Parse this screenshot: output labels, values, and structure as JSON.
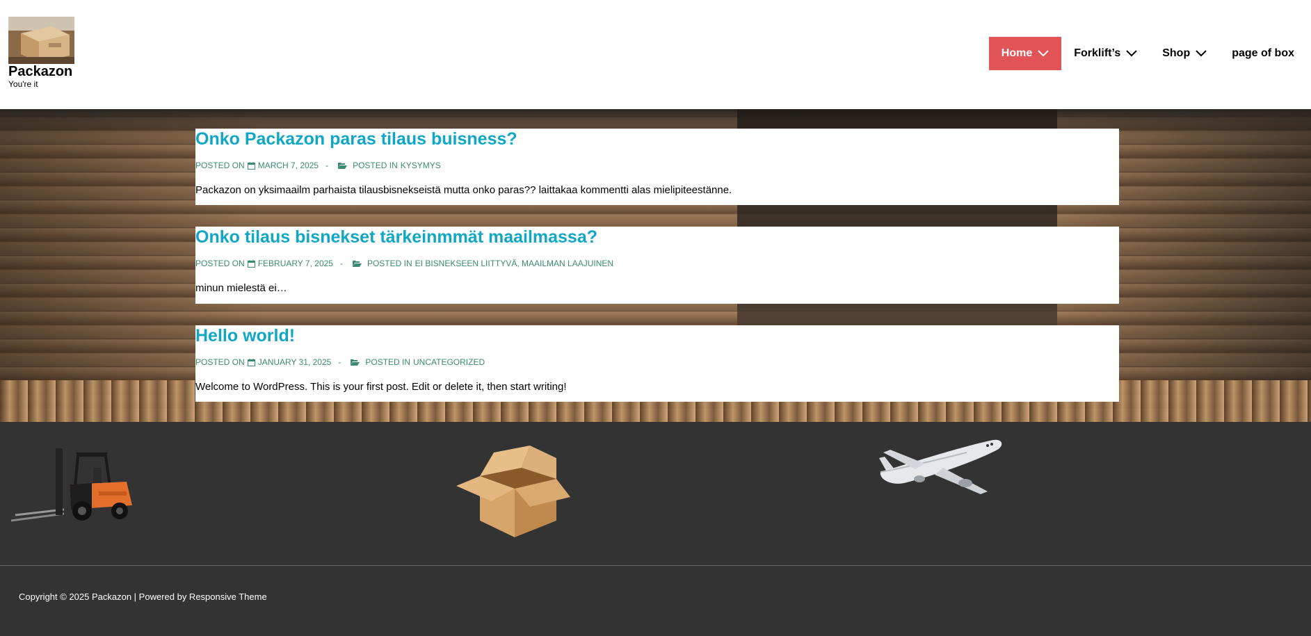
{
  "site": {
    "title": "Packazon",
    "tagline": "You're it"
  },
  "nav": {
    "items": [
      {
        "label": "Home",
        "active": true,
        "has_dropdown": true
      },
      {
        "label": "Forklift’s",
        "active": false,
        "has_dropdown": true
      },
      {
        "label": "Shop",
        "active": false,
        "has_dropdown": true
      },
      {
        "label": "page of box",
        "active": false,
        "has_dropdown": false
      }
    ]
  },
  "posts": [
    {
      "title": "Onko Packazon paras tilaus buisness?",
      "posted_on_label": "POSTED ON",
      "date": "MARCH 7, 2025",
      "posted_in_label": "POSTED IN",
      "categories": "KYSYMYS",
      "excerpt": "Packazon on yksimaailm parhaista  tilausbisnekseistä mutta onko paras?? laittakaa kommentti alas mielipiteestänne."
    },
    {
      "title": "Onko tilaus bisnekset tärkeinmmät maailmassa?",
      "posted_on_label": "POSTED ON",
      "date": "FEBRUARY 7, 2025",
      "posted_in_label": "POSTED IN",
      "categories": "EI BISNEKSEEN LIITTYVÄ, MAAILMAN LAAJUINEN",
      "excerpt": "minun mielestä ei…"
    },
    {
      "title": "Hello world!",
      "posted_on_label": "POSTED ON",
      "date": "JANUARY 31, 2025",
      "posted_in_label": "POSTED IN",
      "categories": "UNCATEGORIZED",
      "excerpt": "Welcome to WordPress. This is your first post. Edit or delete it, then start writing!"
    }
  ],
  "widgets": [
    {
      "icon": "forklift-image"
    },
    {
      "icon": "open-box-image"
    },
    {
      "icon": "airplane-image"
    }
  ],
  "footer": {
    "copyright": "Copyright © 2025 Packazon | Powered by Responsive Theme"
  },
  "colors": {
    "accent_red": "#e35457",
    "title_cyan": "#10a7c7",
    "meta_green": "#3b8a73",
    "footer_bg": "#333333"
  }
}
